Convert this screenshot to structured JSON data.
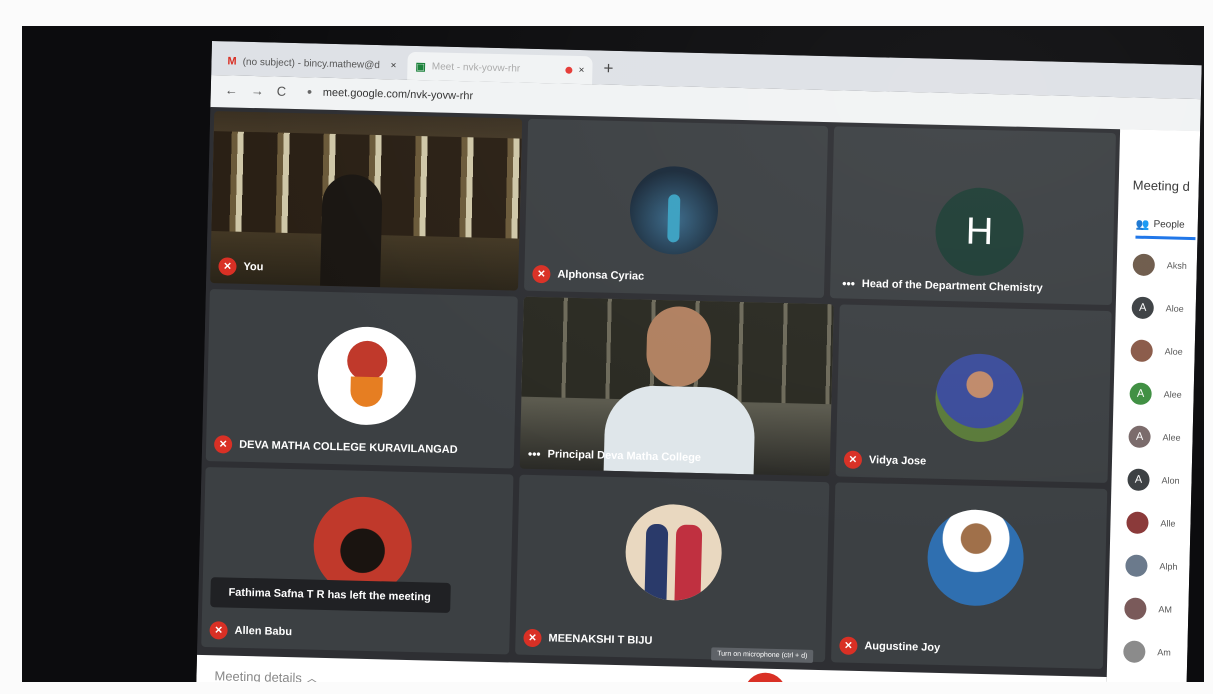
{
  "browser": {
    "tabs": [
      {
        "icon": "M",
        "title": "(no subject) - bincy.mathew@d"
      },
      {
        "icon": "▣",
        "title": "Meet - nvk-yovw-rhr"
      }
    ],
    "tab_close": "×",
    "new_tab": "+",
    "url": "meet.google.com/nvk-yovw-rhr",
    "back": "←",
    "forward": "→",
    "reload": "C"
  },
  "meet": {
    "participants": [
      {
        "name": "You",
        "muted": true
      },
      {
        "name": "Alphonsa Cyriac",
        "muted": true
      },
      {
        "name": "Head of the Department Chemistry",
        "initial": "H",
        "muted": false
      },
      {
        "name": "DEVA MATHA COLLEGE KURAVILANGAD",
        "muted": true
      },
      {
        "name": "Principal Deva Matha College",
        "muted": false
      },
      {
        "name": "Vidya Jose",
        "muted": true
      },
      {
        "name": "Allen Babu",
        "muted": true
      },
      {
        "name": "MEENAKSHI T BIJU",
        "muted": true
      },
      {
        "name": "Augustine Joy",
        "muted": true
      }
    ],
    "toast": "Fathima Safna T R has left the meeting",
    "dots": "•••",
    "mic_glyph": "✕"
  },
  "side_panel": {
    "title": "Meeting d",
    "tab_label": "People",
    "people": [
      {
        "initial": "",
        "name": "Aksh",
        "color": "#6d5a4a"
      },
      {
        "initial": "A",
        "name": "Aloe",
        "color": "#3c4043"
      },
      {
        "initial": "",
        "name": "Aloe",
        "color": "#8a5a48"
      },
      {
        "initial": "A",
        "name": "Alee",
        "color": "#3e8e41"
      },
      {
        "initial": "A",
        "name": "Alee",
        "color": "#7a6a6a"
      },
      {
        "initial": "A",
        "name": "Alon",
        "color": "#3c4043"
      },
      {
        "initial": "",
        "name": "Alle",
        "color": "#8b3a3a"
      },
      {
        "initial": "",
        "name": "Alph",
        "color": "#6b7a8c"
      },
      {
        "initial": "",
        "name": "AM",
        "color": "#7a5a5a"
      },
      {
        "initial": "",
        "name": "Am",
        "color": "#8b8b8b"
      }
    ]
  },
  "bottom_bar": {
    "meeting_details": "Meeting details",
    "chevron": "︿",
    "tooltip": "Turn on microphone (ctrl + d)"
  }
}
